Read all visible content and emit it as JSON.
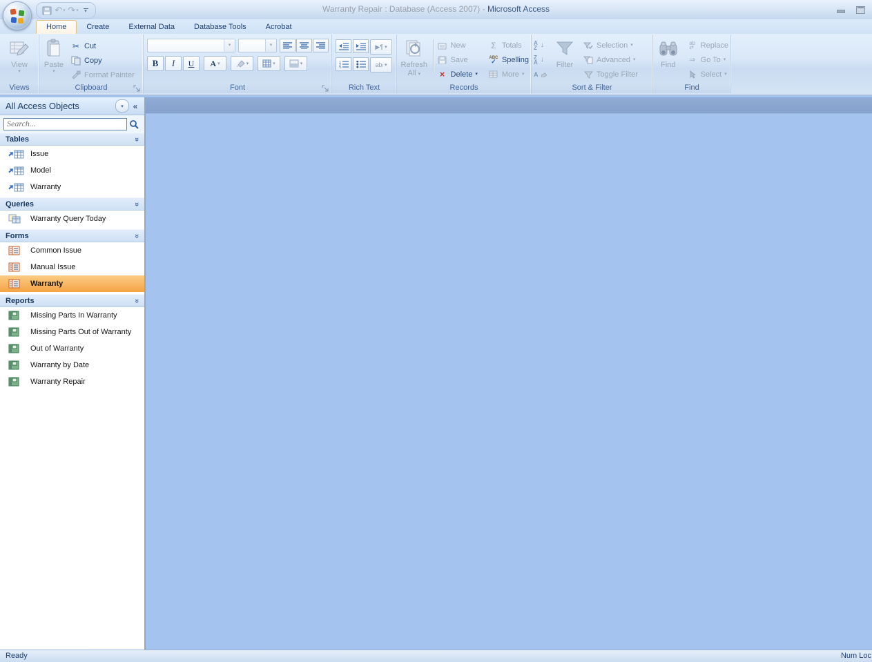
{
  "window": {
    "title_part1": "Warranty Repair : Database (Access 2007) - ",
    "title_part2": "Microsoft Access"
  },
  "tabs": [
    {
      "label": "Home",
      "active": true
    },
    {
      "label": "Create",
      "active": false
    },
    {
      "label": "External Data",
      "active": false
    },
    {
      "label": "Database Tools",
      "active": false
    },
    {
      "label": "Acrobat",
      "active": false
    }
  ],
  "ribbon": {
    "views": {
      "label": "Views",
      "view": "View"
    },
    "clipboard": {
      "label": "Clipboard",
      "paste": "Paste",
      "cut": "Cut",
      "copy": "Copy",
      "format_painter": "Format Painter"
    },
    "font": {
      "label": "Font"
    },
    "rich_text": {
      "label": "Rich Text"
    },
    "records": {
      "label": "Records",
      "refresh_line1": "Refresh",
      "refresh_line2": "All",
      "new": "New",
      "save": "Save",
      "delete": "Delete",
      "totals": "Totals",
      "spelling": "Spelling",
      "more": "More"
    },
    "sort_filter": {
      "label": "Sort & Filter",
      "filter": "Filter",
      "selection": "Selection",
      "advanced": "Advanced",
      "toggle_filter": "Toggle Filter"
    },
    "find": {
      "label": "Find",
      "find": "Find",
      "replace": "Replace",
      "goto": "Go To",
      "select": "Select"
    }
  },
  "nav": {
    "title": "All Access Objects",
    "search_placeholder": "Search...",
    "sections": [
      {
        "title": "Tables",
        "items": [
          "Issue",
          "Model",
          "Warranty"
        ]
      },
      {
        "title": "Queries",
        "items": [
          "Warranty Query Today"
        ]
      },
      {
        "title": "Forms",
        "items": [
          "Common Issue",
          "Manual Issue",
          "Warranty"
        ],
        "selected": "Warranty"
      },
      {
        "title": "Reports",
        "items": [
          "Missing Parts In Warranty",
          "Missing Parts Out of Warranty",
          "Out of Warranty",
          "Warranty by Date",
          "Warranty Repair"
        ]
      }
    ]
  },
  "statusbar": {
    "left": "Ready",
    "right": "Num Loc"
  },
  "icons": {
    "dropdown": "▾",
    "undo": "↶",
    "redo": "↷",
    "cut": "✂",
    "delete-x": "×",
    "totals": "Σ",
    "goto-arrow": "⇒",
    "shutter": "«",
    "collapse-chevron": "» rotated up",
    "paragraph": "¶",
    "bold": "B",
    "italic": "I",
    "underline": "U",
    "font-color": "A"
  },
  "colors": {
    "selection_orange": "#f4a445",
    "workspace_blue": "#a4c3ef",
    "workspace_band": "#88a4ce",
    "active_tab_cream": "#fbf4e4",
    "enabled_text": "#264a7d",
    "disabled_text": "#9aa7b7"
  }
}
